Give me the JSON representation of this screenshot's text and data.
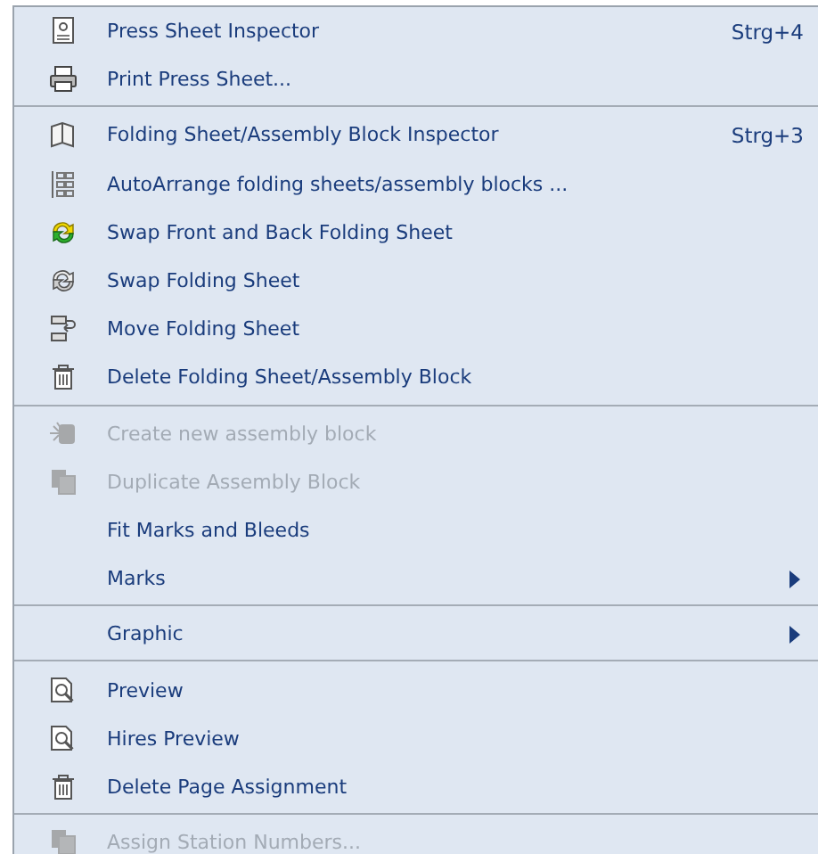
{
  "menu": {
    "groups": [
      {
        "items": [
          {
            "label": "Press Sheet Inspector",
            "shortcut": "Strg+4",
            "kind": "sheet",
            "disabled": false
          },
          {
            "label": "Print Press Sheet...",
            "kind": "printer",
            "disabled": false
          }
        ]
      },
      {
        "items": [
          {
            "label": "Folding Sheet/Assembly Block Inspector",
            "shortcut": "Strg+3",
            "kind": "fold",
            "disabled": false
          },
          {
            "label": "AutoArrange folding sheets/assembly blocks ...",
            "kind": "grid",
            "disabled": false
          },
          {
            "label": "Swap Front and Back Folding Sheet",
            "kind": "swapcolor",
            "disabled": false
          },
          {
            "label": "Swap Folding Sheet",
            "kind": "swap",
            "disabled": false
          },
          {
            "label": "Move Folding Sheet",
            "kind": "move",
            "disabled": false
          },
          {
            "label": "Delete Folding Sheet/Assembly Block",
            "kind": "trash",
            "disabled": false
          }
        ]
      },
      {
        "items": [
          {
            "label": "Create new assembly block",
            "kind": "create",
            "disabled": true
          },
          {
            "label": "Duplicate Assembly Block",
            "kind": "pages",
            "disabled": true
          },
          {
            "label": "Fit Marks and Bleeds",
            "kind": "plain",
            "disabled": false
          },
          {
            "label": "Marks",
            "kind": "plain",
            "disabled": false,
            "submenu": true
          }
        ]
      },
      {
        "items": [
          {
            "label": "Graphic",
            "kind": "plain",
            "disabled": false,
            "submenu": true
          }
        ]
      },
      {
        "items": [
          {
            "label": "Preview",
            "kind": "preview",
            "disabled": false
          },
          {
            "label": "Hires Preview",
            "kind": "preview",
            "disabled": false
          },
          {
            "label": "Delete Page Assignment",
            "kind": "trash",
            "disabled": false
          }
        ]
      },
      {
        "items": [
          {
            "label": "Assign Station Numbers...",
            "kind": "pages",
            "disabled": true
          }
        ]
      }
    ]
  }
}
